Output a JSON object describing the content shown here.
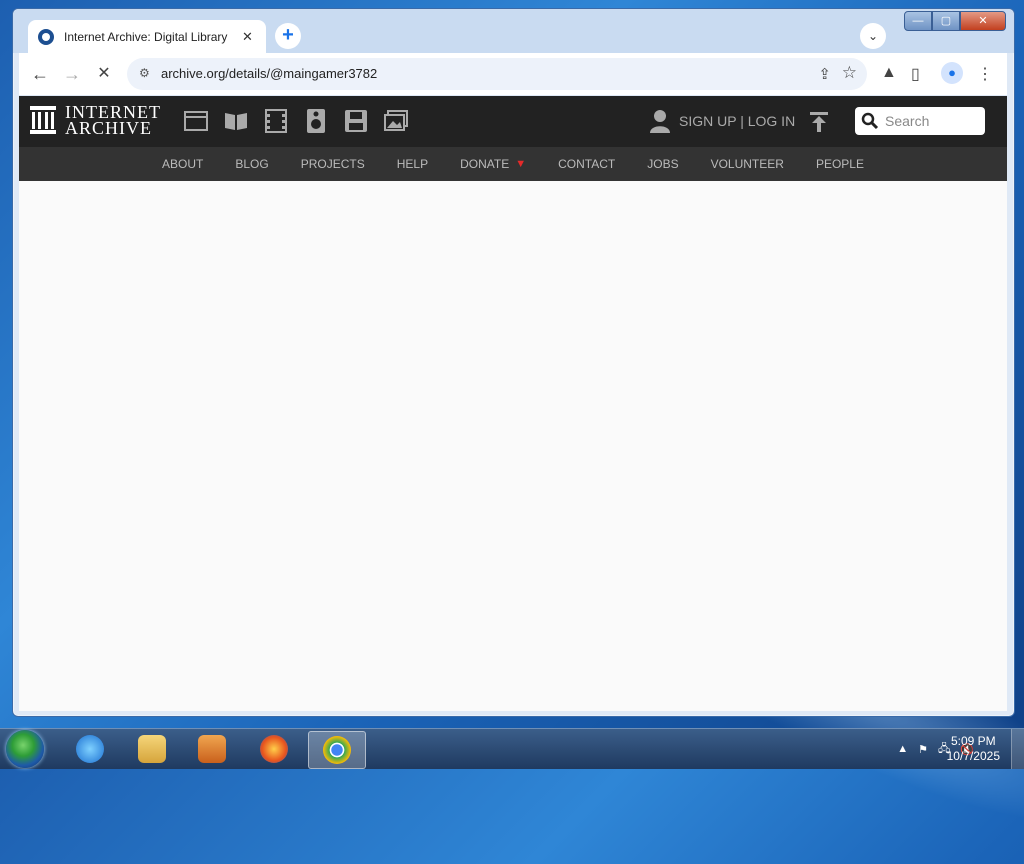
{
  "browser": {
    "tab_title": "Internet Archive: Digital Library",
    "tab_close": "✕",
    "new_tab": "+",
    "tab_search": "⌄",
    "url": "archive.org/details/@maingamer3782",
    "window_controls": {
      "minimize": "—",
      "maximize": "▢",
      "close": "✕"
    }
  },
  "ia": {
    "logo_line1": "INTERNET",
    "logo_line2": "ARCHIVE",
    "auth_text": "SIGN UP | LOG IN",
    "search_placeholder": "Search",
    "media_icons": [
      "web-icon",
      "texts-icon",
      "video-icon",
      "audio-icon",
      "software-icon",
      "images-icon"
    ],
    "nav": [
      {
        "label": "ABOUT"
      },
      {
        "label": "BLOG"
      },
      {
        "label": "PROJECTS"
      },
      {
        "label": "HELP"
      },
      {
        "label": "DONATE"
      },
      {
        "label": "CONTACT"
      },
      {
        "label": "JOBS"
      },
      {
        "label": "VOLUNTEER"
      },
      {
        "label": "PEOPLE"
      }
    ]
  },
  "taskbar": {
    "apps": [
      "internet-explorer-icon",
      "file-explorer-icon",
      "media-player-icon",
      "firefox-icon",
      "chrome-icon"
    ],
    "time": "5:09 PM",
    "date": "10/7/2025"
  },
  "colors": {
    "ia_header_bg": "#222222",
    "ia_nav_bg": "#333333",
    "donate_accent": "#e62a2a"
  }
}
